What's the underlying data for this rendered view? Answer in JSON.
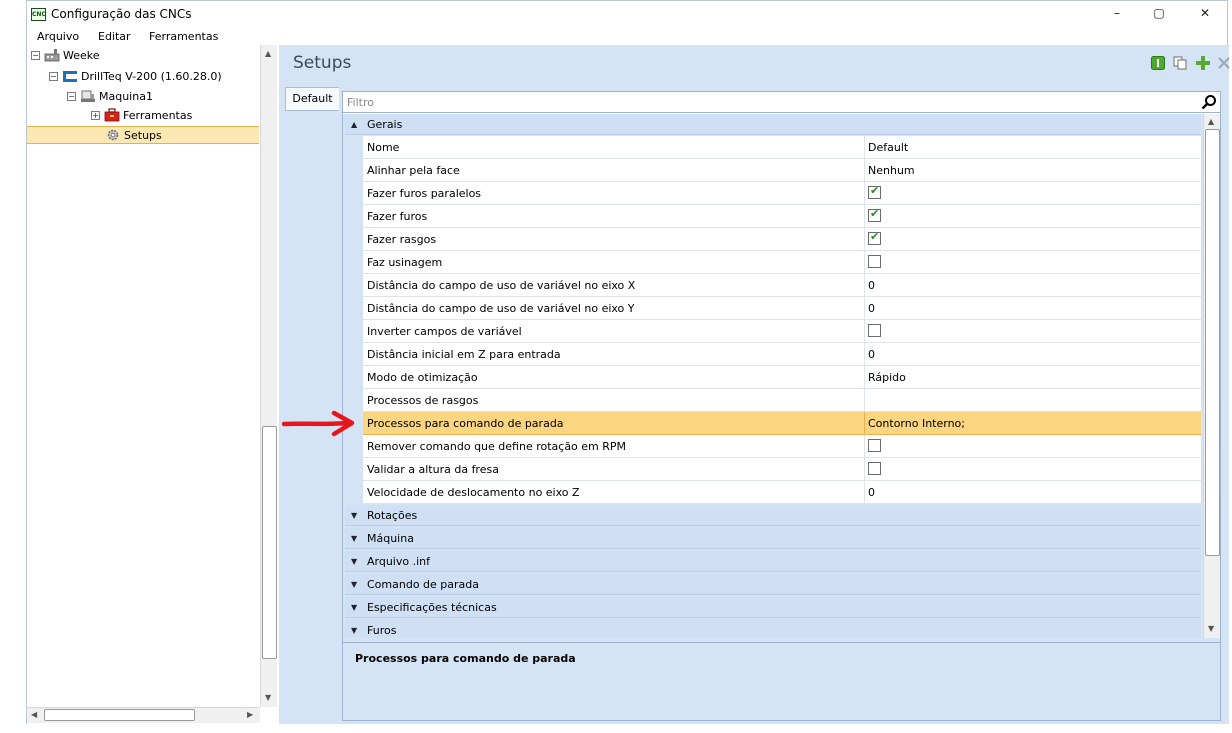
{
  "window": {
    "title": "Configuração das CNCs",
    "minimize": "–",
    "restore": "▢",
    "close": "✕"
  },
  "menu": [
    "Arquivo",
    "Editar",
    "Ferramentas"
  ],
  "tree": {
    "root": "Weeke",
    "machine": "DrillTeq V-200 (1.60.28.0)",
    "maquina": "Maquina1",
    "ferramentas": "Ferramentas",
    "setups": "Setups"
  },
  "content": {
    "title": "Setups",
    "tab": "Default",
    "filter_placeholder": "Filtro"
  },
  "categories": {
    "gerais": "Gerais",
    "collapsed": [
      "Rotações",
      "Máquina",
      "Arquivo .inf",
      "Comando de parada",
      "Especificações técnicas",
      "Furos"
    ]
  },
  "properties": [
    {
      "name": "Nome",
      "value": "Default",
      "type": "text"
    },
    {
      "name": "Alinhar pela face",
      "value": "Nenhum",
      "type": "text"
    },
    {
      "name": "Fazer furos paralelos",
      "value": "",
      "checked": true,
      "type": "check"
    },
    {
      "name": "Fazer furos",
      "value": "",
      "checked": true,
      "type": "check"
    },
    {
      "name": "Fazer rasgos",
      "value": "",
      "checked": true,
      "type": "check"
    },
    {
      "name": "Faz usinagem",
      "value": "",
      "checked": false,
      "type": "check"
    },
    {
      "name": "Distância do campo de uso de variável no eixo X",
      "value": "0",
      "type": "text"
    },
    {
      "name": "Distância do campo de uso de variável no eixo Y",
      "value": "0",
      "type": "text"
    },
    {
      "name": "Inverter campos de variável",
      "value": "",
      "checked": false,
      "type": "check"
    },
    {
      "name": "Distância inicial em Z para entrada",
      "value": "0",
      "type": "text"
    },
    {
      "name": "Modo de otimização",
      "value": "Rápido",
      "type": "text"
    },
    {
      "name": "Processos de rasgos",
      "value": "",
      "type": "text"
    },
    {
      "name": "Processos para comando de parada",
      "value": "Contorno Interno;",
      "type": "text",
      "selected": true
    },
    {
      "name": "Remover comando que define rotação em RPM",
      "value": "",
      "checked": false,
      "type": "check"
    },
    {
      "name": "Validar a altura da fresa",
      "value": "",
      "checked": false,
      "type": "check"
    },
    {
      "name": "Velocidade de deslocamento no eixo Z",
      "value": "0",
      "type": "text"
    }
  ],
  "description": {
    "title": "Processos para comando de parada"
  },
  "colors": {
    "selected_row": "#fbd580",
    "panel_bg": "#d5e4f5",
    "arrow": "#e8151b"
  }
}
